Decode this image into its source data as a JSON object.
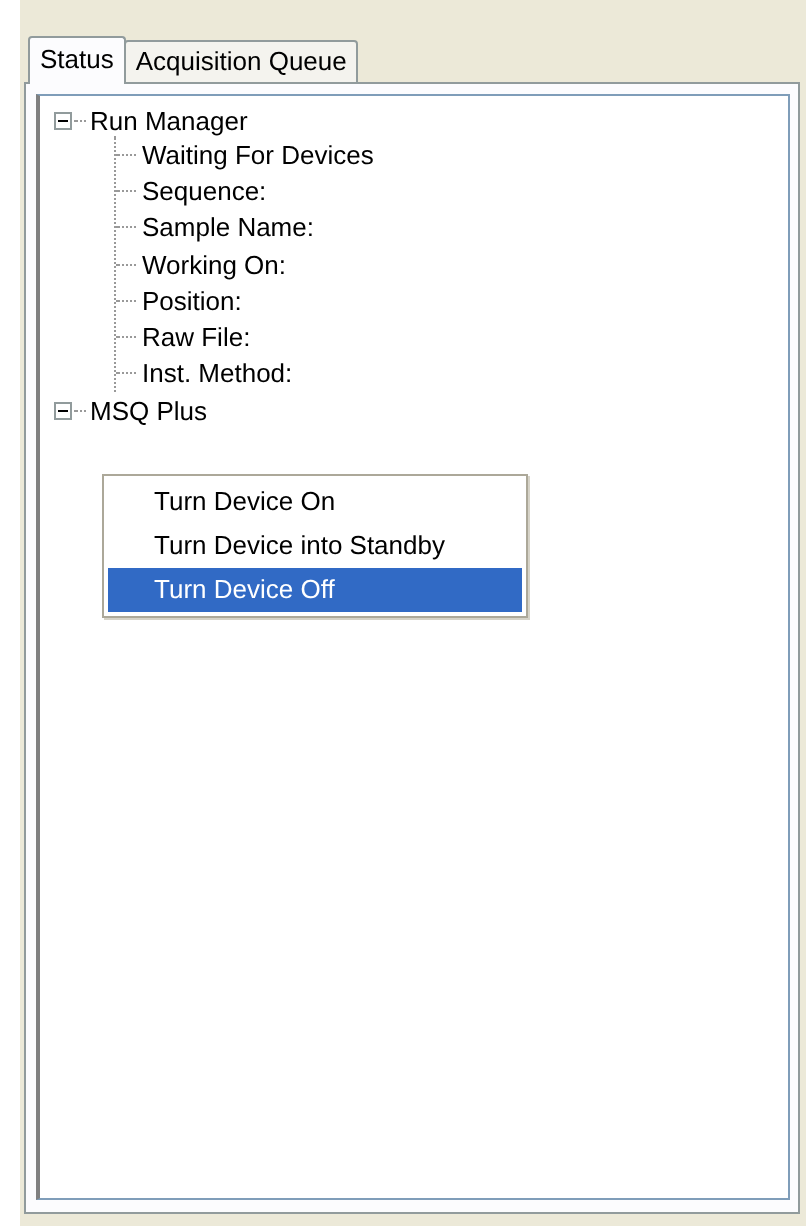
{
  "tabs": [
    {
      "label": "Status",
      "selected": true
    },
    {
      "label": "Acquisition Queue",
      "selected": false
    }
  ],
  "tree": [
    {
      "label": "Run Manager",
      "expanded": true,
      "children": [
        {
          "label": "Waiting For Devices"
        },
        {
          "label": "Sequence:"
        },
        {
          "label": "Sample Name:"
        },
        {
          "label": "Working On:"
        },
        {
          "label": "Position:"
        },
        {
          "label": "Raw File:"
        },
        {
          "label": "Inst. Method:"
        }
      ]
    },
    {
      "label": "MSQ Plus",
      "expanded": true
    }
  ],
  "context_menu": [
    {
      "label": "Turn Device On",
      "selected": false
    },
    {
      "label": "Turn Device into Standby",
      "selected": false
    },
    {
      "label": "Turn Device Off",
      "selected": true
    }
  ]
}
